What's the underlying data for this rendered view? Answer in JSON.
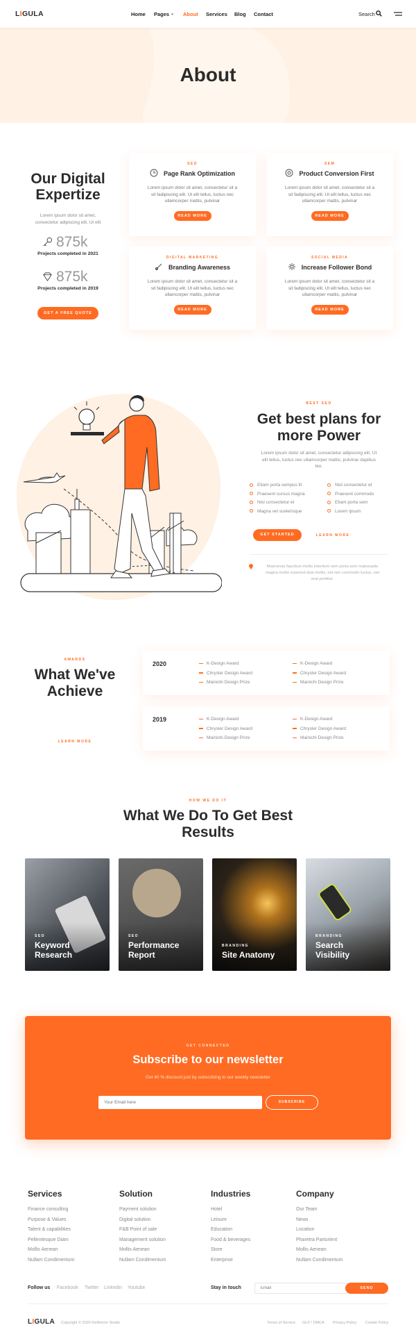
{
  "brand": {
    "pre": "L",
    "accent": "I",
    "post": "GULA"
  },
  "nav": {
    "home": "Home",
    "pages": "Pages",
    "about": "About",
    "services": "Services",
    "blog": "Blog",
    "contact": "Contact",
    "search": "Search"
  },
  "hero": {
    "title": "About"
  },
  "expertise": {
    "title_1": "Our Digital",
    "title_2": "Expertize",
    "desc_1": "Lorem ipsum dolor sit amet,",
    "desc_2": "consectetur adipiscing elit. Ut elit",
    "stat1_value": "875k",
    "stat1_label": "Projects completed in 2021",
    "stat2_value": "875k",
    "stat2_label": "Projects completed in 2019",
    "cta": "GET A FREE QUOTE"
  },
  "cards": [
    {
      "tag": "SEO",
      "title": "Page Rank Optimization",
      "t1": "Lorem ipsum dolor sit amet, consectetur sit a",
      "t2": "sit fadipiscing elit. Ut elit tellus, luctus nec",
      "t3": "ullamcorper mattis, pulvinar",
      "btn": "READ MORE"
    },
    {
      "tag": "SEM",
      "title": "Product Conversion First",
      "t1": "Lorem ipsum dolor sit amet, consectetur sit a",
      "t2": "sit fadipiscing elit. Ut elit tellus, luctus nec",
      "t3": "ullamcorper mattis, pulvinar",
      "btn": "READ MORE"
    },
    {
      "tag": "DIGITAL MARKETING",
      "title": "Branding Awareness",
      "t1": "Lorem ipsum dolor sit amet, consectetur sit a",
      "t2": "sit fadipiscing elit. Ut elit tellus, luctus nec",
      "t3": "ullamcorper mattis, pulvinar",
      "btn": "READ MORE"
    },
    {
      "tag": "SOCIAL MEDIA",
      "title": "Increase Follower Bond",
      "t1": "Lorem ipsum dolor sit amet, consectetur sit a",
      "t2": "sit fadipiscing elit. Ut elit tellus, luctus nec",
      "t3": "ullamcorper mattis, pulvinar",
      "btn": "READ MORE"
    }
  ],
  "plans": {
    "tag": "BEST SEO",
    "title_1": "Get best plans for",
    "title_2": "more Power",
    "d1": "Lorem ipsum dolor sit amet, consectetur adipiscing elit. Ut",
    "d2": "elit tellus, luctus nec ullamcorper mattis, pulvinar dapibus",
    "d3": "leo.",
    "list": [
      "Etiam porta sempus lit",
      "Nisl consectetur et",
      "Praesent cursus magna",
      "Praesent commodo",
      "Nisl consectetur et",
      "Etiam porta sem",
      "Magna vel scelerisque",
      "Lorem ipsum"
    ],
    "btn1": "GET STARTED",
    "btn2": "LEARN MORE",
    "note1": "Maecenas faucibus mollis interdum sem porta sem malesuada",
    "note2": "magna mollis euismod duis mollis, est non commodo luctus, nisi",
    "note3": "erat porttitor."
  },
  "awards": {
    "tag": "AWARDS",
    "title_1": "What We've",
    "title_2": "Achieve",
    "link": "LEARN MORE",
    "years": [
      {
        "year": "2020",
        "items": [
          "K-Design Award",
          "Chrysler Design Award",
          "Mainichi Design Prize",
          "K-Design Award",
          "Chrysler Design Award",
          "Mainichi Design Prize"
        ]
      },
      {
        "year": "2019",
        "items": [
          "K-Design Award",
          "Chrysler Design Award",
          "Mainichi Design Prize",
          "K-Design Award",
          "Chrysler Design Award",
          "Mainichi Design Prize"
        ]
      }
    ]
  },
  "howwedo": {
    "tag": "HOW WE DO IT",
    "title_1": "What We Do To Get Best",
    "title_2": "Results",
    "items": [
      {
        "tag": "SEO",
        "n1": "Keyword",
        "n2": "Research"
      },
      {
        "tag": "SEO",
        "n1": "Performance",
        "n2": "Report"
      },
      {
        "tag": "BRANDING",
        "n1": "Site Anatomy",
        "n2": ""
      },
      {
        "tag": "BRANDING",
        "n1": "Search",
        "n2": "Visibility"
      }
    ]
  },
  "newsletter": {
    "tag": "GET CONNECTED",
    "title": "Subscribe to our newsletter",
    "sub": "Get 40 % discount just by subscribing to our weekly newsletter",
    "placeholder": "Your Email here",
    "btn": "SUBSCRIBE"
  },
  "footer": {
    "cols": [
      {
        "title": "Services",
        "items": [
          "Finance consulting",
          "Purpose & Values",
          "Talent & capabilities",
          "Pellentesque Diam",
          "Mollis Aenean",
          "Nullam Condimentum"
        ]
      },
      {
        "title": "Solution",
        "items": [
          "Payment solution",
          "Digital solution",
          "F&B Point of sale",
          "Management solution",
          "Mollis Aenean",
          "Nullam Condimentum"
        ]
      },
      {
        "title": "Industries",
        "items": [
          "Hotel",
          "Leisure",
          "Education",
          "Food & beverages",
          "Store",
          "Enterprise"
        ]
      },
      {
        "title": "Company",
        "items": [
          "Our Team",
          "News",
          "Location",
          "Pharetra Parturient",
          "Mollis Aenean",
          "Nullam Condimentum"
        ]
      }
    ],
    "follow": "Follow us",
    "social": [
      "Facebook",
      "Twitter",
      "Linkedin",
      "Youtube"
    ],
    "stay": "Stay in touch",
    "email_placeholder": "Email",
    "send": "SEND",
    "copyright": "Copyright © 2020 Deltheme Studio",
    "links": [
      "Terms of Service",
      "GLP / DMCA",
      "Privacy Policy",
      "Cookie Policy"
    ]
  },
  "colors": {
    "accent": "#ff6b22",
    "hero_bg": "#fff1e3"
  }
}
